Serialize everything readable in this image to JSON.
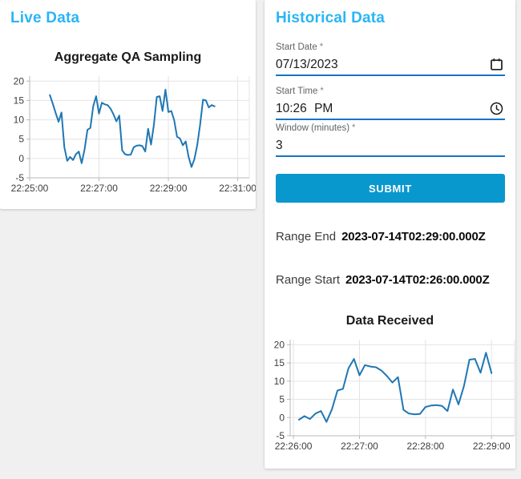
{
  "live_panel": {
    "heading": "Live Data"
  },
  "historical_panel": {
    "heading": "Historical Data",
    "fields": [
      {
        "label": "Start Date",
        "required_marker": "*",
        "value": "07/13/2023",
        "icon": "calendar-icon"
      },
      {
        "label": "Start Time",
        "required_marker": "*",
        "value": "10:26 PM",
        "icon": "clock-icon"
      },
      {
        "label": "Window (minutes)",
        "required_marker": "*",
        "value": "3",
        "icon": null
      }
    ],
    "submit_label": "SUBMIT",
    "range_end": {
      "label": "Range End",
      "value": "2023-07-14T02:29:00.000Z"
    },
    "range_start": {
      "label": "Range Start",
      "value": "2023-07-14T02:26:00.000Z"
    }
  },
  "colors": {
    "heading_accent": "#29b5f6",
    "field_underline": "#1674c5",
    "submit_background": "#0998cd",
    "submit_text": "#ffffff",
    "line": "#1f77b4",
    "grid": "#e4e4e4",
    "axis": "#b9b9b9",
    "tick_text": "#3d3d3d",
    "page_background": "#f0f0f1",
    "card_background": "#ffffff"
  },
  "chart_data": [
    {
      "type": "line",
      "title": "Aggregate QA Sampling",
      "xlabel": "",
      "ylabel": "",
      "x_unit": "seconds after 22:25:00",
      "xlim": [
        0,
        380
      ],
      "ylim": [
        -5,
        21.3
      ],
      "yticks": [
        -5,
        0,
        5,
        10,
        15,
        20
      ],
      "xticks": [
        {
          "t": 0,
          "label": "22:25:00"
        },
        {
          "t": 120,
          "label": "22:27:00"
        },
        {
          "t": 240,
          "label": "22:29:00"
        },
        {
          "t": 360,
          "label": "22:31:00"
        }
      ],
      "grid": true,
      "legend": false,
      "x": [
        35,
        40,
        45,
        50,
        55,
        60,
        65,
        70,
        75,
        80,
        85,
        90,
        95,
        100,
        105,
        110,
        115,
        120,
        125,
        130,
        135,
        140,
        145,
        150,
        155,
        160,
        165,
        170,
        175,
        180,
        185,
        190,
        195,
        200,
        205,
        210,
        215,
        220,
        225,
        230,
        235,
        240,
        245,
        250,
        255,
        260,
        265,
        270,
        275,
        280,
        285,
        290,
        295,
        300,
        305,
        310,
        315,
        320
      ],
      "values": [
        16.4,
        14.2,
        11.8,
        9.5,
        11.9,
        2.9,
        -0.6,
        0.4,
        -0.4,
        1.1,
        1.8,
        -1.2,
        2.3,
        7.4,
        7.9,
        13.5,
        16.1,
        11.6,
        14.4,
        14.0,
        13.8,
        12.9,
        11.4,
        9.6,
        11.1,
        2.1,
        1.1,
        0.9,
        1.0,
        2.9,
        3.3,
        3.4,
        3.2,
        1.8,
        7.7,
        3.6,
        8.7,
        15.9,
        16.1,
        12.3,
        17.8,
        12.0,
        12.3,
        9.9,
        5.6,
        5.2,
        3.4,
        4.4,
        0.4,
        -2.2,
        -0.2,
        3.5,
        8.8,
        15.2,
        15.0,
        13.2,
        13.8,
        13.5
      ]
    },
    {
      "type": "line",
      "title": "Data Received",
      "xlabel": "",
      "ylabel": "",
      "x_unit": "seconds after 22:26:00",
      "xlim": [
        -3,
        201
      ],
      "ylim": [
        -5,
        21.4
      ],
      "yticks": [
        -5,
        0,
        5,
        10,
        15,
        20
      ],
      "xticks": [
        {
          "t": 0,
          "label": "22:26:00"
        },
        {
          "t": 60,
          "label": "22:27:00"
        },
        {
          "t": 120,
          "label": "22:28:00"
        },
        {
          "t": 180,
          "label": "22:29:00"
        }
      ],
      "grid": true,
      "legend": false,
      "x": [
        5,
        10,
        15,
        20,
        25,
        30,
        35,
        40,
        45,
        50,
        55,
        60,
        65,
        70,
        75,
        80,
        85,
        90,
        95,
        100,
        105,
        110,
        115,
        120,
        125,
        130,
        135,
        140,
        145,
        150,
        155,
        160,
        165,
        170,
        175,
        180
      ],
      "values": [
        -0.6,
        0.4,
        -0.4,
        1.1,
        1.8,
        -1.2,
        2.3,
        7.4,
        7.9,
        13.5,
        16.1,
        11.6,
        14.4,
        14.0,
        13.8,
        12.9,
        11.4,
        9.6,
        11.1,
        2.1,
        1.1,
        0.9,
        1.0,
        2.9,
        3.3,
        3.4,
        3.2,
        1.8,
        7.7,
        3.6,
        8.7,
        15.9,
        16.1,
        12.3,
        17.8,
        12.2
      ]
    }
  ]
}
